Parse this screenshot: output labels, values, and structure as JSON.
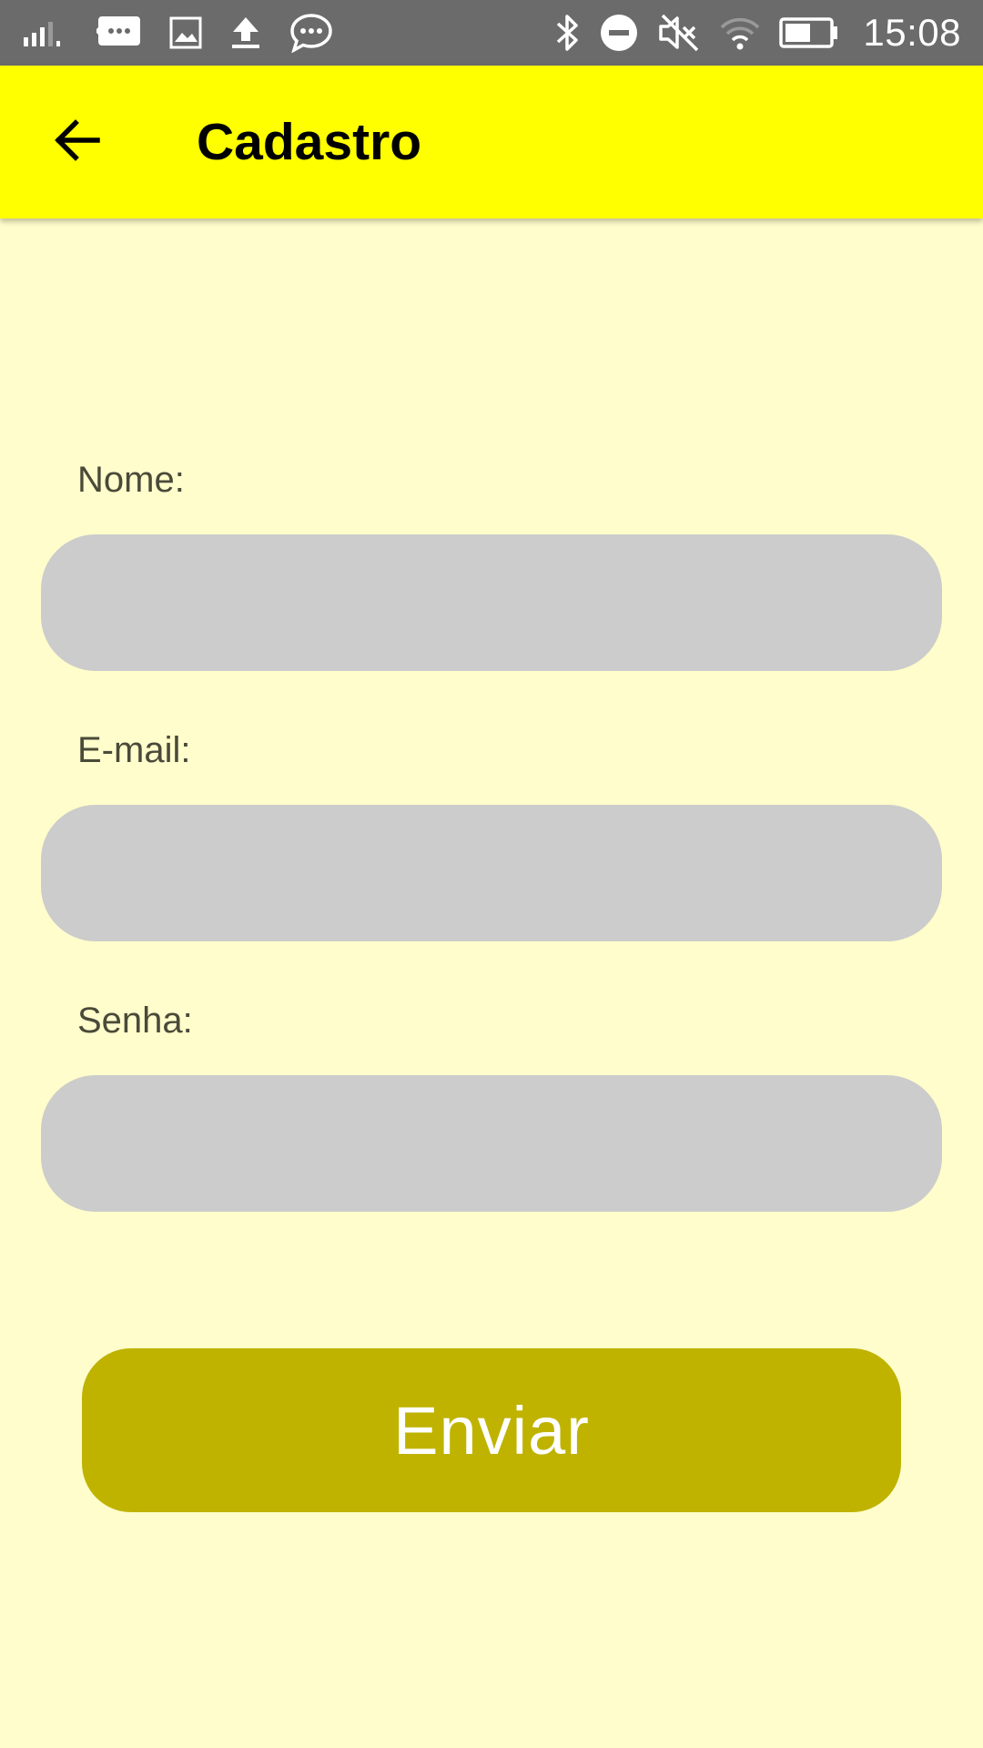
{
  "status_bar": {
    "time": "15:08",
    "left_icons": [
      "signal-icon",
      "message-bubble-icon",
      "image-icon",
      "upload-icon",
      "chat-icon"
    ],
    "right_icons": [
      "bluetooth-icon",
      "do-not-disturb-icon",
      "mute-icon",
      "wifi-icon",
      "battery-icon"
    ],
    "background": "#6B6B6B"
  },
  "app_bar": {
    "title": "Cadastro",
    "back_icon": "arrow-back-icon",
    "background": "#FFFF00"
  },
  "form": {
    "fields": [
      {
        "label": "Nome:",
        "value": "",
        "placeholder": ""
      },
      {
        "label": "E-mail:",
        "value": "",
        "placeholder": ""
      },
      {
        "label": "Senha:",
        "value": "",
        "placeholder": ""
      }
    ],
    "submit_label": "Enviar",
    "input_color": "#CCCCCC",
    "button_color": "#BFB300"
  },
  "page": {
    "background": "#FFFDCB"
  }
}
